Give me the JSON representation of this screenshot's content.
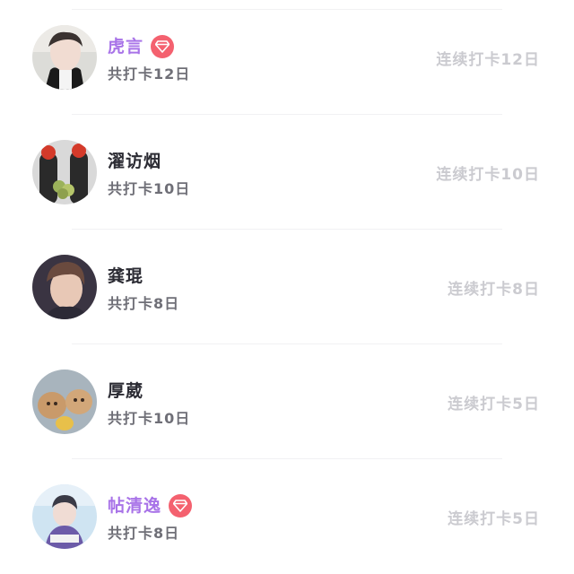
{
  "checkin_list": {
    "items": [
      {
        "name": "虎言",
        "vip": true,
        "total": "共打卡12日",
        "streak": "连续打卡12日"
      },
      {
        "name": "濯访烟",
        "vip": false,
        "total": "共打卡10日",
        "streak": "连续打卡10日"
      },
      {
        "name": "龚琨",
        "vip": false,
        "total": "共打卡8日",
        "streak": "连续打卡8日"
      },
      {
        "name": "厚葳",
        "vip": false,
        "total": "共打卡10日",
        "streak": "连续打卡5日"
      },
      {
        "name": "帖清逸",
        "vip": true,
        "total": "共打卡8日",
        "streak": "连续打卡5日"
      }
    ]
  },
  "colors": {
    "vip_name": "#a873e8",
    "vip_badge": "#f4616f",
    "name": "#2c2c34",
    "secondary": "#6f6f77",
    "streak": "#cbcbd0"
  }
}
